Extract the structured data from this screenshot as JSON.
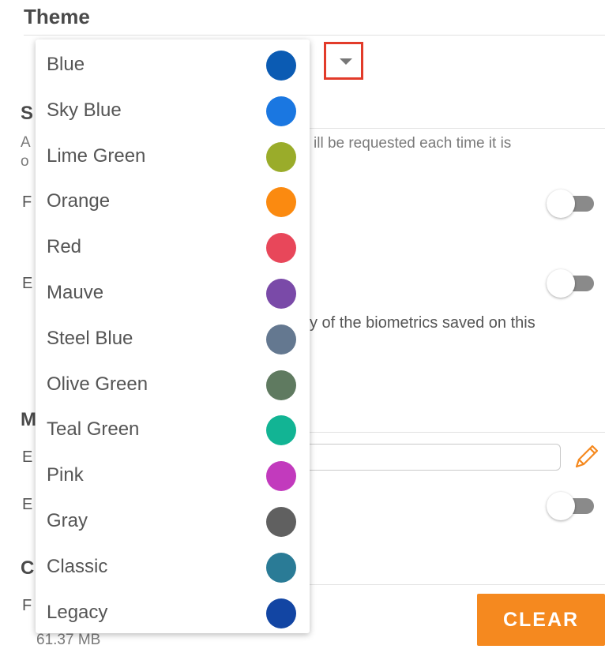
{
  "theme": {
    "title": "Theme",
    "dropdown_icon": "caret-down-icon",
    "options": [
      {
        "label": "Blue",
        "color": "#0b5bb3"
      },
      {
        "label": "Sky Blue",
        "color": "#1a77e1"
      },
      {
        "label": "Lime Green",
        "color": "#9aac2a"
      },
      {
        "label": "Orange",
        "color": "#fb8a10"
      },
      {
        "label": "Red",
        "color": "#e8475a"
      },
      {
        "label": "Mauve",
        "color": "#7a4aa8"
      },
      {
        "label": "Steel Blue",
        "color": "#647890"
      },
      {
        "label": "Olive Green",
        "color": "#5f7a60"
      },
      {
        "label": "Teal Green",
        "color": "#12b494"
      },
      {
        "label": "Pink",
        "color": "#c23abd"
      },
      {
        "label": "Gray",
        "color": "#606060"
      },
      {
        "label": "Classic",
        "color": "#2a7b96"
      },
      {
        "label": "Legacy",
        "color": "#1245a3"
      }
    ]
  },
  "background": {
    "section_s": "S",
    "section_s_desc_1_prefix": "A",
    "section_s_desc_1_suffix": "ill be requested each time it is",
    "section_s_desc_2_prefix": "o",
    "row1_prefix": "F",
    "row2_prefix": "E",
    "row2_desc_suffix": "y of the biometrics saved on this",
    "section_m": "M",
    "row3_prefix": "E",
    "row4_prefix": "E",
    "section_c": "C",
    "row5_prefix": "F",
    "size_text": "61.37 MB",
    "clear_label": "CLEAR",
    "edit_icon": "pencil-icon"
  },
  "colors": {
    "accent": "#f5891f",
    "highlight_border": "#e23b2a"
  }
}
